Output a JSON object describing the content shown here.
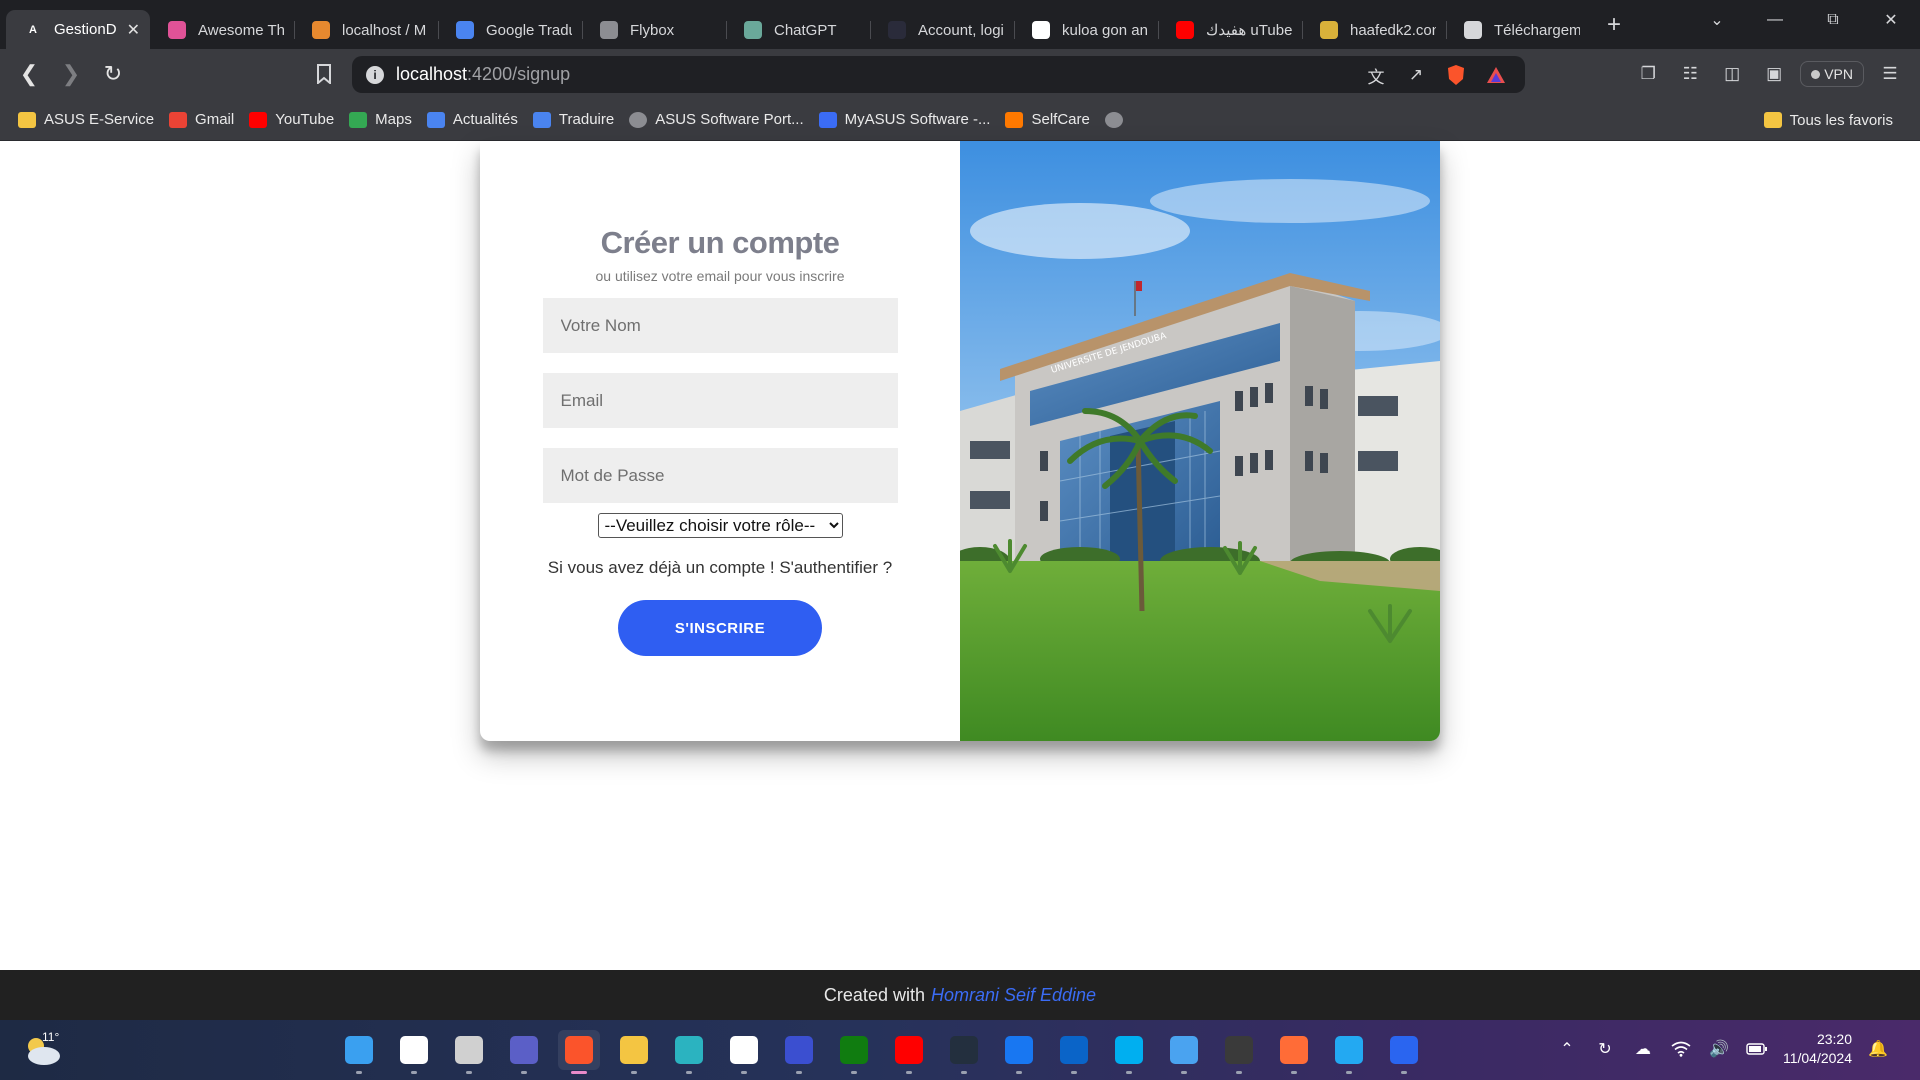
{
  "browser": {
    "tabs": [
      {
        "title": "GestionD",
        "favicon": "angular-icon",
        "color": "#ffffff",
        "active": true
      },
      {
        "title": "Awesome Th",
        "favicon": "colorful-icon",
        "color": "#e05297"
      },
      {
        "title": "localhost / M",
        "favicon": "phpmyadmin-icon",
        "color": "#e7892f"
      },
      {
        "title": "Google Tradu",
        "favicon": "translate-icon",
        "color": "#4a84f0"
      },
      {
        "title": "Flybox",
        "favicon": "globe-icon",
        "color": "#8c8d92"
      },
      {
        "title": "ChatGPT",
        "favicon": "chatgpt-icon",
        "color": "#6aa89a"
      },
      {
        "title": "Account, logi",
        "favicon": "dark-icon",
        "color": "#2a2b3a"
      },
      {
        "title": "kuloa gon an",
        "favicon": "google-icon",
        "color": "#ffffff"
      },
      {
        "title": "هفيدك uTube",
        "favicon": "youtube-icon",
        "color": "#ff0000"
      },
      {
        "title": "haafedk2.con",
        "favicon": "shield-icon",
        "color": "#d9b13a"
      },
      {
        "title": "Téléchargeme",
        "favicon": "download-icon",
        "color": "#d6d7da"
      }
    ],
    "address": {
      "host": "localhost",
      "path": ":4200/signup"
    },
    "vpn_label": "VPN",
    "bookmarks": [
      {
        "label": "ASUS E-Service",
        "icon": "folder-icon",
        "color": "#f4c542"
      },
      {
        "label": "Gmail",
        "icon": "gmail-icon",
        "color": "#ea4335"
      },
      {
        "label": "YouTube",
        "icon": "youtube-icon",
        "color": "#ff0000"
      },
      {
        "label": "Maps",
        "icon": "maps-icon",
        "color": "#34a853"
      },
      {
        "label": "Actualités",
        "icon": "news-icon",
        "color": "#4a84f0"
      },
      {
        "label": "Traduire",
        "icon": "translate-icon",
        "color": "#4a84f0"
      },
      {
        "label": "ASUS Software Port...",
        "icon": "globe-icon",
        "color": "#8c8d92"
      },
      {
        "label": "MyASUS Software -...",
        "icon": "asus-icon",
        "color": "#3b6cf5"
      },
      {
        "label": "SelfCare",
        "icon": "orange-icon",
        "color": "#ff7900"
      },
      {
        "label": "",
        "icon": "globe-icon",
        "color": "#8c8d92"
      }
    ],
    "bookmarks_all": "Tous les favoris"
  },
  "signup": {
    "title": "Créer un compte",
    "subtitle": "ou utilisez votre email pour vous inscrire",
    "name_placeholder": "Votre Nom",
    "email_placeholder": "Email",
    "password_placeholder": "Mot de Passe",
    "role_selected": "--Veuillez choisir votre rôle--",
    "login_prompt": "Si vous avez déjà un compte ! S'authentifier ?",
    "submit_label": "S'INSCRIRE",
    "accent_color": "#2f5ef2",
    "building_sign": "UNIVERSITE DE JENDOUBA"
  },
  "footer": {
    "prefix": "Created with",
    "author": "Homrani Seif Eddine"
  },
  "taskbar": {
    "weather_temp": "11°",
    "apps": [
      {
        "name": "windows-start-icon",
        "color": "#3aa0f0"
      },
      {
        "name": "search-icon",
        "color": "#ffffff"
      },
      {
        "name": "task-view-icon",
        "color": "#d0d0d0"
      },
      {
        "name": "teams-icon",
        "color": "#5b5fc7"
      },
      {
        "name": "brave-icon",
        "color": "#fb542b",
        "active": true
      },
      {
        "name": "file-explorer-icon",
        "color": "#f4c542"
      },
      {
        "name": "edge-icon",
        "color": "#2bb3c0"
      },
      {
        "name": "microsoft-store-icon",
        "color": "#ffffff"
      },
      {
        "name": "mathway-icon",
        "color": "#3b4fd0"
      },
      {
        "name": "xbox-icon",
        "color": "#107c10"
      },
      {
        "name": "youtube-icon",
        "color": "#ff0000"
      },
      {
        "name": "amazon-icon",
        "color": "#232f3e"
      },
      {
        "name": "facebook-icon",
        "color": "#1877f2"
      },
      {
        "name": "outlook-icon",
        "color": "#0a64c8"
      },
      {
        "name": "skype-icon",
        "color": "#00aff0"
      },
      {
        "name": "remote-app-icon",
        "color": "#4aa3f0"
      },
      {
        "name": "terminal-icon",
        "color": "#3a3a3a"
      },
      {
        "name": "postman-icon",
        "color": "#ff6c37"
      },
      {
        "name": "vscode-icon",
        "color": "#23a9f2"
      },
      {
        "name": "css3-icon",
        "color": "#2a65f0"
      }
    ],
    "time": "23:20",
    "date": "11/04/2024"
  }
}
